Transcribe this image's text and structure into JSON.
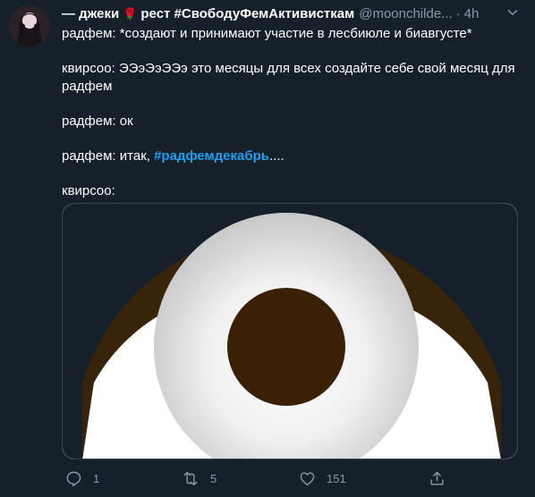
{
  "tweet": {
    "display_name": "— джеки",
    "display_name_suffix": "рест #СвободуФемАктивисткам",
    "handle": "@moonchilde...",
    "separator": "·",
    "time": "4h",
    "more_label": "⌄",
    "lines": [
      "радфем: *создают и принимают участие в лесбиюле и биавгусте*",
      "квирсоо: ЭЭэЭэЭЭэ это месяцы для всех создайте себе свой месяц для радфем",
      "радфем: ок",
      "радфем: итак, ",
      "#радфемдекабрь",
      "....",
      "квирсоо:"
    ]
  },
  "actions": {
    "reply_count": "1",
    "retweet_count": "5",
    "like_count": "151",
    "icons": [
      "reply-icon",
      "retweet-icon",
      "like-icon",
      "share-icon"
    ]
  },
  "colors": {
    "background": "#15202b",
    "text": "#ffffff",
    "secondary": "#8899a6",
    "link": "#1da1f2",
    "iris": "#3a2106",
    "eyelid": "#37240b"
  }
}
